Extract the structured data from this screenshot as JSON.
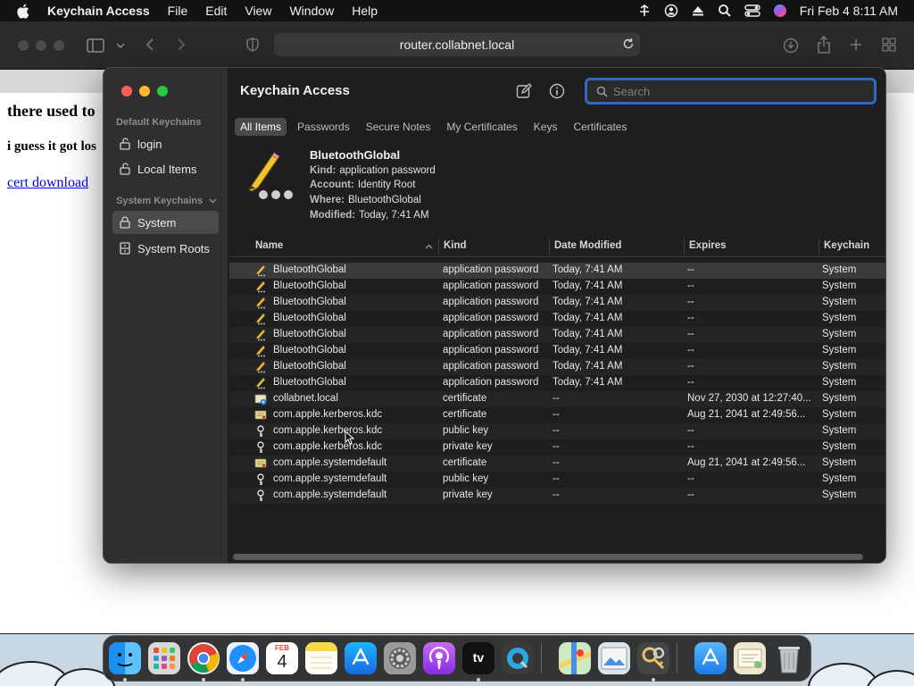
{
  "menubar": {
    "app_name": "Keychain Access",
    "menus": [
      "File",
      "Edit",
      "View",
      "Window",
      "Help"
    ],
    "clock": "Fri Feb 4  8:11 AM"
  },
  "safari": {
    "url": "router.collabnet.local"
  },
  "webpage": {
    "heading": "there used to",
    "subheading": "i guess it got los",
    "link": "cert download"
  },
  "keychain": {
    "title": "Keychain Access",
    "search_placeholder": "Search",
    "sidebar": {
      "default_section": "Default Keychains",
      "default_items": [
        "login",
        "Local Items"
      ],
      "system_section": "System Keychains",
      "system_items": [
        "System",
        "System Roots"
      ]
    },
    "tabs": [
      "All Items",
      "Passwords",
      "Secure Notes",
      "My Certificates",
      "Keys",
      "Certificates"
    ],
    "detail": {
      "title": "BluetoothGlobal",
      "kind_label": "Kind:",
      "kind": "application password",
      "account_label": "Account:",
      "account": "Identity Root",
      "where_label": "Where:",
      "where": "BluetoothGlobal",
      "modified_label": "Modified:",
      "modified": "Today, 7:41 AM"
    },
    "columns": [
      "Name",
      "Kind",
      "Date Modified",
      "Expires",
      "Keychain"
    ],
    "rows": [
      {
        "icon": "pencil",
        "name": "BluetoothGlobal",
        "kind": "application password",
        "modified": "Today, 7:41 AM",
        "expires": "--",
        "keychain": "System"
      },
      {
        "icon": "pencil",
        "name": "BluetoothGlobal",
        "kind": "application password",
        "modified": "Today, 7:41 AM",
        "expires": "--",
        "keychain": "System"
      },
      {
        "icon": "pencil",
        "name": "BluetoothGlobal",
        "kind": "application password",
        "modified": "Today, 7:41 AM",
        "expires": "--",
        "keychain": "System"
      },
      {
        "icon": "pencil",
        "name": "BluetoothGlobal",
        "kind": "application password",
        "modified": "Today, 7:41 AM",
        "expires": "--",
        "keychain": "System"
      },
      {
        "icon": "pencil",
        "name": "BluetoothGlobal",
        "kind": "application password",
        "modified": "Today, 7:41 AM",
        "expires": "--",
        "keychain": "System"
      },
      {
        "icon": "pencil",
        "name": "BluetoothGlobal",
        "kind": "application password",
        "modified": "Today, 7:41 AM",
        "expires": "--",
        "keychain": "System"
      },
      {
        "icon": "pencil",
        "name": "BluetoothGlobal",
        "kind": "application password",
        "modified": "Today, 7:41 AM",
        "expires": "--",
        "keychain": "System"
      },
      {
        "icon": "pencil",
        "name": "BluetoothGlobal",
        "kind": "application password",
        "modified": "Today, 7:41 AM",
        "expires": "--",
        "keychain": "System"
      },
      {
        "icon": "cert-blue",
        "name": "collabnet.local",
        "kind": "certificate",
        "modified": "--",
        "expires": "Nov 27, 2030 at 12:27:40...",
        "keychain": "System"
      },
      {
        "icon": "cert",
        "name": "com.apple.kerberos.kdc",
        "kind": "certificate",
        "modified": "--",
        "expires": "Aug 21, 2041 at 2:49:56...",
        "keychain": "System"
      },
      {
        "icon": "key",
        "name": "com.apple.kerberos.kdc",
        "kind": "public key",
        "modified": "--",
        "expires": "--",
        "keychain": "System"
      },
      {
        "icon": "key",
        "name": "com.apple.kerberos.kdc",
        "kind": "private key",
        "modified": "--",
        "expires": "--",
        "keychain": "System"
      },
      {
        "icon": "cert",
        "name": "com.apple.systemdefault",
        "kind": "certificate",
        "modified": "--",
        "expires": "Aug 21, 2041 at 2:49:56...",
        "keychain": "System"
      },
      {
        "icon": "key",
        "name": "com.apple.systemdefault",
        "kind": "public key",
        "modified": "--",
        "expires": "--",
        "keychain": "System"
      },
      {
        "icon": "key",
        "name": "com.apple.systemdefault",
        "kind": "private key",
        "modified": "--",
        "expires": "--",
        "keychain": "System"
      }
    ]
  },
  "dock": {
    "apps": [
      "finder-icon",
      "launchpad-icon",
      "chrome-icon",
      "safari-icon",
      "calendar-icon",
      "notes-icon",
      "app-store-icon",
      "system-preferences-icon",
      "podcasts-icon",
      "apple-tv-icon",
      "quicktime-icon",
      "maps-icon",
      "preview-icon",
      "keychain-access-icon",
      "downloads-stack-icon",
      "documents-stack-icon",
      "trash-icon"
    ],
    "calendar_month": "FEB",
    "calendar_day": "4",
    "tv_label": "tv"
  },
  "colors": {
    "accent": "#2c6bbf",
    "close": "#ff5f57",
    "minimize": "#febc2e",
    "zoom": "#28c840"
  }
}
